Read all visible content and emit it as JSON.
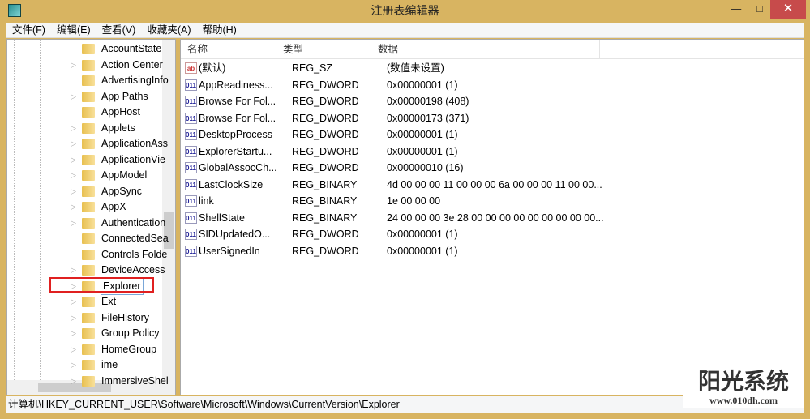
{
  "window": {
    "title": "注册表编辑器",
    "minimize": "—",
    "maximize": "□",
    "close": "✕"
  },
  "menu": [
    "文件(F)",
    "编辑(E)",
    "查看(V)",
    "收藏夹(A)",
    "帮助(H)"
  ],
  "tree": {
    "items": [
      {
        "label": "AccountState",
        "arrow": ""
      },
      {
        "label": "Action Center",
        "arrow": "▷"
      },
      {
        "label": "AdvertisingInfo",
        "arrow": ""
      },
      {
        "label": "App Paths",
        "arrow": "▷"
      },
      {
        "label": "AppHost",
        "arrow": ""
      },
      {
        "label": "Applets",
        "arrow": "▷"
      },
      {
        "label": "ApplicationAss",
        "arrow": "▷"
      },
      {
        "label": "ApplicationVie",
        "arrow": "▷"
      },
      {
        "label": "AppModel",
        "arrow": "▷"
      },
      {
        "label": "AppSync",
        "arrow": "▷"
      },
      {
        "label": "AppX",
        "arrow": "▷"
      },
      {
        "label": "Authentication",
        "arrow": "▷"
      },
      {
        "label": "ConnectedSea",
        "arrow": ""
      },
      {
        "label": "Controls Folde",
        "arrow": ""
      },
      {
        "label": "DeviceAccess",
        "arrow": "▷"
      },
      {
        "label": "Explorer",
        "arrow": "▷"
      },
      {
        "label": "Ext",
        "arrow": "▷"
      },
      {
        "label": "FileHistory",
        "arrow": "▷"
      },
      {
        "label": "Group Policy",
        "arrow": "▷"
      },
      {
        "label": "HomeGroup",
        "arrow": "▷"
      },
      {
        "label": "ime",
        "arrow": "▷"
      },
      {
        "label": "ImmersiveShel",
        "arrow": "▷"
      }
    ],
    "selected": "Explorer"
  },
  "list": {
    "headers": [
      "名称",
      "类型",
      "数据"
    ],
    "rows": [
      {
        "icon": "ab",
        "name": "(默认)",
        "type": "REG_SZ",
        "data": "(数值未设置)"
      },
      {
        "icon": "011",
        "name": "AppReadiness...",
        "type": "REG_DWORD",
        "data": "0x00000001 (1)"
      },
      {
        "icon": "011",
        "name": "Browse For Fol...",
        "type": "REG_DWORD",
        "data": "0x00000198 (408)"
      },
      {
        "icon": "011",
        "name": "Browse For Fol...",
        "type": "REG_DWORD",
        "data": "0x00000173 (371)"
      },
      {
        "icon": "011",
        "name": "DesktopProcess",
        "type": "REG_DWORD",
        "data": "0x00000001 (1)"
      },
      {
        "icon": "011",
        "name": "ExplorerStartu...",
        "type": "REG_DWORD",
        "data": "0x00000001 (1)"
      },
      {
        "icon": "011",
        "name": "GlobalAssocCh...",
        "type": "REG_DWORD",
        "data": "0x00000010 (16)"
      },
      {
        "icon": "011",
        "name": "LastClockSize",
        "type": "REG_BINARY",
        "data": "4d 00 00 00 11 00 00 00 6a 00 00 00 11 00 00..."
      },
      {
        "icon": "011",
        "name": "link",
        "type": "REG_BINARY",
        "data": "1e 00 00 00"
      },
      {
        "icon": "011",
        "name": "ShellState",
        "type": "REG_BINARY",
        "data": "24 00 00 00 3e 28 00 00 00 00 00 00 00 00 00..."
      },
      {
        "icon": "011",
        "name": "SIDUpdatedO...",
        "type": "REG_DWORD",
        "data": "0x00000001 (1)"
      },
      {
        "icon": "011",
        "name": "UserSignedIn",
        "type": "REG_DWORD",
        "data": "0x00000001 (1)"
      }
    ]
  },
  "status": "计算机\\HKEY_CURRENT_USER\\Software\\Microsoft\\Windows\\CurrentVersion\\Explorer",
  "watermark": {
    "title": "阳光系统",
    "url": "www.010dh.com"
  }
}
